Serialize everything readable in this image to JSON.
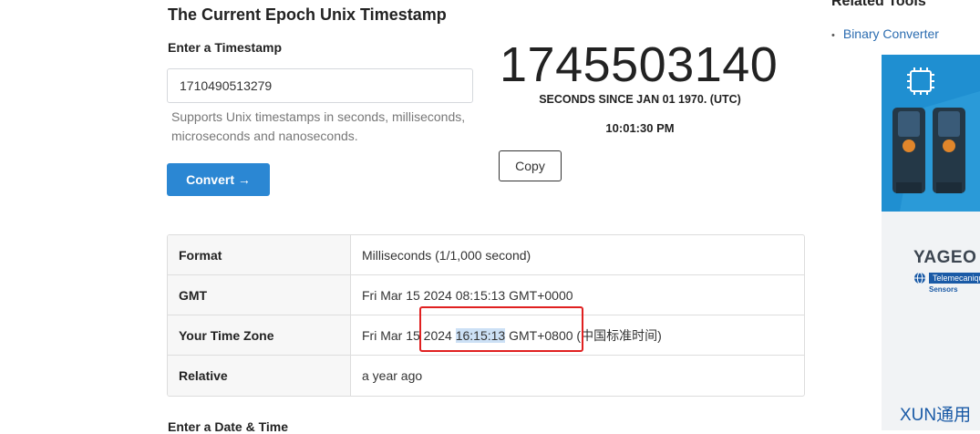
{
  "main": {
    "title": "The Current Epoch Unix Timestamp",
    "enter_label": "Enter a Timestamp",
    "input_value": "1710490513279",
    "help_text": "Supports Unix timestamps in seconds, milliseconds, microseconds and nanoseconds.",
    "convert_label": "Convert →",
    "bottom_label": "Enter a Date & Time"
  },
  "epoch": {
    "number": "1745503140",
    "caption": "SECONDS SINCE JAN 01 1970. (UTC)",
    "time": "10:01:30 PM",
    "copy_label": "Copy"
  },
  "table": {
    "rows": [
      {
        "key": "Format",
        "value": "Milliseconds (1/1,000 second)"
      },
      {
        "key": "GMT",
        "value": "Fri Mar 15 2024 08:15:13 GMT+0000"
      },
      {
        "key": "Your Time Zone",
        "value_pre": "Fri Mar 15 2024 ",
        "value_sel": "16:15:13",
        "value_post": " GMT+0800 (中国标准时间)"
      },
      {
        "key": "Relative",
        "value": "a year ago"
      }
    ]
  },
  "sidebar": {
    "related_title": "Related Tools",
    "links": [
      "Binary Converter"
    ]
  },
  "ad": {
    "brand": "YAGEO",
    "sub_brand": "Telemecanique",
    "sensors_label": "Sensors",
    "tagline": "XUN通用"
  },
  "colors": {
    "accent": "#2b87d3",
    "highlight_box": "#e02020",
    "selection": "#cce0f5",
    "link": "#2b6cb0"
  }
}
